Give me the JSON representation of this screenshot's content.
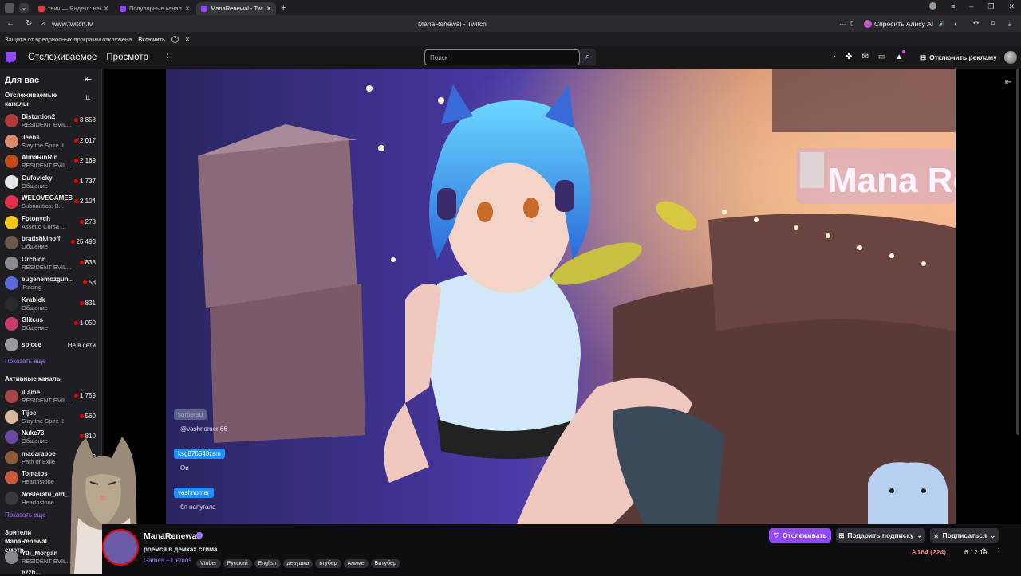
{
  "browser": {
    "tabs": [
      {
        "title": "твич — Яндекс: нашлось",
        "favicon_color": "#e03b3b"
      },
      {
        "title": "Популярные каналы - Tw",
        "favicon_color": "#9146ff"
      },
      {
        "title": "ManaRenewal - Twitch",
        "favicon_color": "#9146ff",
        "active": true
      }
    ],
    "url": "www.twitch.tv",
    "page_title": "ManaRenewal - Twitch",
    "alice_label": "Спросить Алису AI",
    "protection_text": "Защита от вредоносных программ отключена",
    "enable_label": "Включить"
  },
  "topnav": {
    "following": "Отслеживаемое",
    "browse": "Просмотр",
    "search_placeholder": "Поиск",
    "adfree_label": "Отключить рекламу"
  },
  "sidebar": {
    "for_you": "Для вас",
    "followed_title": "Отслеживаемые каналы",
    "followed": [
      {
        "name": "Distortion2",
        "game": "RESIDENT EVIL...",
        "viewers": "8 858",
        "color": "#b33a3a"
      },
      {
        "name": "Jeens",
        "game": "Slay the Spire II",
        "viewers": "2 017",
        "color": "#d98a6a"
      },
      {
        "name": "AlinaRinRin",
        "game": "RESIDENT EVIL...",
        "viewers": "2 169",
        "color": "#c24a1a"
      },
      {
        "name": "Gufovicky",
        "game": "Общение",
        "viewers": "1 737",
        "color": "#e8e8e8"
      },
      {
        "name": "WELOVEGAMES",
        "game": "Subnautica: B...",
        "viewers": "2 104",
        "color": "#e0304a"
      },
      {
        "name": "Fotonych",
        "game": "Assetto Corsa ...",
        "viewers": "278",
        "color": "#f5c518"
      },
      {
        "name": "bratishkinoff",
        "game": "Общение",
        "viewers": "25 493",
        "color": "#6a5a4a"
      },
      {
        "name": "Orchion",
        "game": "RESIDENT EVIL...",
        "viewers": "838",
        "color": "#8a8a8a"
      },
      {
        "name": "eugenemozgun...",
        "game": "iRacing",
        "viewers": "58",
        "color": "#5a6ad8"
      },
      {
        "name": "Krabick",
        "game": "Общение",
        "viewers": "831",
        "color": "#2a2a2a"
      },
      {
        "name": "Glitcus",
        "game": "Общение",
        "viewers": "1 050",
        "color": "#c83a6a"
      },
      {
        "name": "spicee",
        "game": "",
        "viewers": "Не в сети",
        "color": "#9a9a9a",
        "offline": true
      }
    ],
    "show_more": "Показать еще",
    "active_title": "Активные каналы",
    "active": [
      {
        "name": "iLame",
        "game": "RESIDENT EVIL...",
        "viewers": "1 759",
        "color": "#a44"
      },
      {
        "name": "Tijoe",
        "game": "Slay the Spire II",
        "viewers": "560",
        "color": "#d8b8a0"
      },
      {
        "name": "Nuke73",
        "game": "Общение",
        "viewers": "810",
        "color": "#6a4aa0"
      },
      {
        "name": "madarapoe",
        "game": "Path of Exile",
        "viewers": "88",
        "color": "#8a5a3a"
      },
      {
        "name": "Tomatos",
        "game": "Hearthstone",
        "viewers": "",
        "color": "#c85a3a"
      },
      {
        "name": "Nosferatu_old_",
        "game": "Hearthstone",
        "viewers": "",
        "color": "#3a3a3a"
      }
    ],
    "show_more2": "Показать еще",
    "viewers_title": "Зрители ManaRenewal смотр...",
    "viewers_item": {
      "name": "Yui_Morgan",
      "game": "RESIDENT EVIL..."
    },
    "partial_item": "ezzh..."
  },
  "chat_overlay": [
    {
      "user": "sorpersu",
      "msg": "@vashnomer 66"
    },
    {
      "user": "ksg876543zsm",
      "msg": "Ои"
    },
    {
      "user": "vashnomer",
      "msg": "бл напугала"
    }
  ],
  "scene": {
    "sign_text": "Mana Re"
  },
  "channel": {
    "name": "ManaRenewal",
    "title": "роемся в демках стима",
    "category": "Games + Demos",
    "tags": [
      "Vtuber",
      "Русский",
      "English",
      "девушка",
      "втубер",
      "Аниме",
      "Витубер"
    ],
    "follow_label": "Отслеживать",
    "gift_label": "Подарить подписку",
    "subscribe_label": "Подписаться",
    "viewer_count": "164 (224)",
    "uptime": "6:12:19"
  },
  "colors": {
    "accent": "#9146ff",
    "live": "#eb0400",
    "link": "#a970ff"
  }
}
